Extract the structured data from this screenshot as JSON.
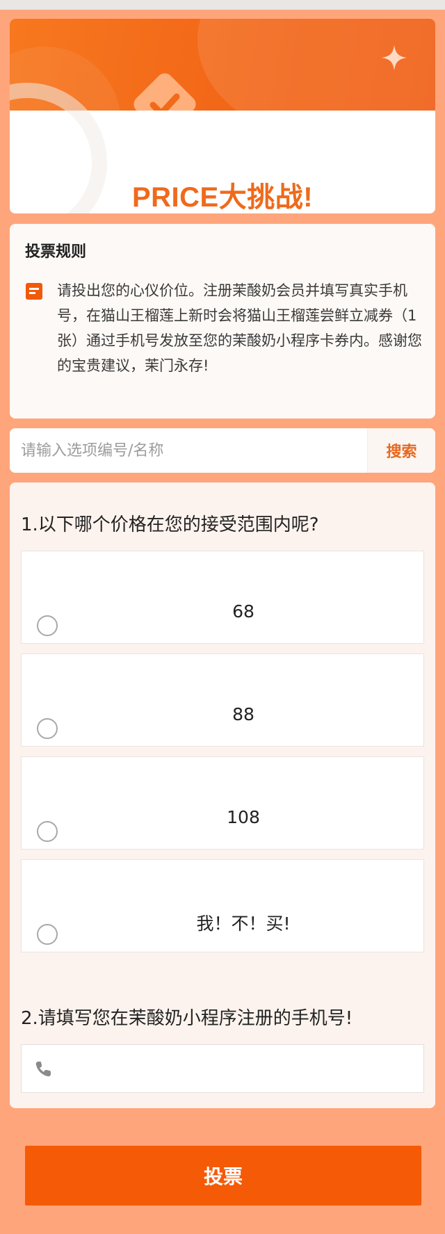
{
  "banner": {
    "title": "PRICE大挑战!",
    "icons": [
      "check-badge-icon",
      "sparkle-icon"
    ]
  },
  "rules": {
    "title": "投票规则",
    "icon": "document-icon",
    "text": "请投出您的心仪价位。注册茉酸奶会员并填写真实手机号，在猫山王榴莲上新时会将猫山王榴莲尝鲜立减券（1张）通过手机号发放至您的茉酸奶小程序卡券内。感谢您的宝贵建议，茉门永存!"
  },
  "search": {
    "placeholder": "请输入选项编号/名称",
    "button_label": "搜索"
  },
  "question1": {
    "title": "1.以下哪个价格在您的接受范围内呢?",
    "options": [
      {
        "label": "68",
        "selected": false
      },
      {
        "label": "88",
        "selected": false
      },
      {
        "label": "108",
        "selected": false
      },
      {
        "label": "我！不！买!",
        "selected": false
      }
    ]
  },
  "question2": {
    "title": "2.请填写您在茉酸奶小程序注册的手机号!",
    "icon": "phone-icon",
    "value": ""
  },
  "submit": {
    "label": "投票"
  },
  "colors": {
    "accent": "#f55a06",
    "page_background": "#ffa57c",
    "title_orange": "#ef6a1c"
  }
}
